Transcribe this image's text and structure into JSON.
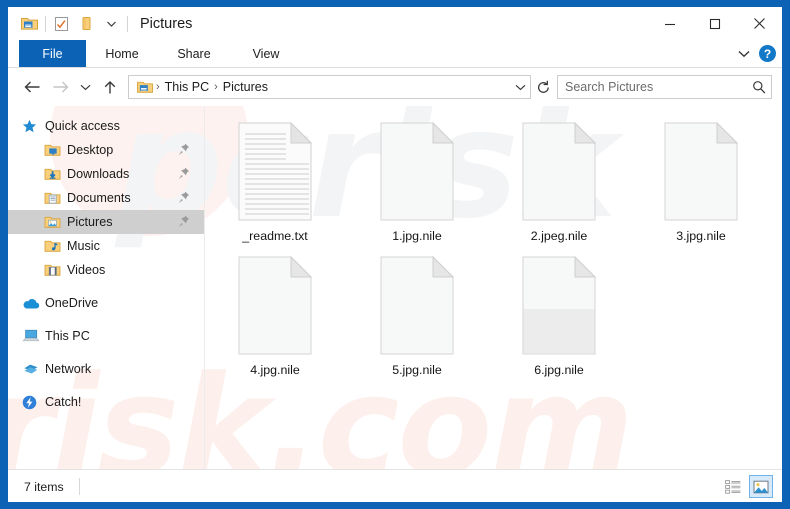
{
  "window": {
    "title": "Pictures",
    "frame_color": "#0c62b5",
    "accent_color": "#0c62b5"
  },
  "quick_access_toolbar": {
    "items": [
      {
        "name": "explorer-icon",
        "label": "Pictures properties"
      },
      {
        "name": "properties-icon",
        "label": "Properties"
      },
      {
        "name": "new-folder-icon",
        "label": "New folder"
      },
      {
        "name": "customize-chevron-icon",
        "label": "Customize Quick Access Toolbar"
      }
    ]
  },
  "window_controls": {
    "minimize": "Minimize",
    "maximize": "Maximize",
    "close": "Close"
  },
  "ribbon": {
    "tabs": [
      {
        "label": "File",
        "selected": true
      },
      {
        "label": "Home",
        "selected": false
      },
      {
        "label": "Share",
        "selected": false
      },
      {
        "label": "View",
        "selected": false
      }
    ],
    "expand_label": "Expand the Ribbon",
    "help_label": "?"
  },
  "navigation": {
    "back": "Back",
    "forward": "Forward",
    "recent": "Recent locations",
    "up": "Up",
    "refresh": "Refresh"
  },
  "address_bar": {
    "crumbs": [
      {
        "label": "This PC"
      },
      {
        "label": "Pictures"
      }
    ],
    "separator": "›"
  },
  "search": {
    "placeholder": "Search Pictures",
    "value": ""
  },
  "sidebar": {
    "items": [
      {
        "label": "Quick access",
        "icon": "star-icon",
        "type": "root",
        "selected": false,
        "pinned": false
      },
      {
        "label": "Desktop",
        "icon": "folder-desktop-icon",
        "type": "child",
        "selected": false,
        "pinned": true
      },
      {
        "label": "Downloads",
        "icon": "folder-downloads-icon",
        "type": "child",
        "selected": false,
        "pinned": true
      },
      {
        "label": "Documents",
        "icon": "folder-documents-icon",
        "type": "child",
        "selected": false,
        "pinned": true
      },
      {
        "label": "Pictures",
        "icon": "folder-pictures-icon",
        "type": "child",
        "selected": true,
        "pinned": true
      },
      {
        "label": "Music",
        "icon": "folder-music-icon",
        "type": "child",
        "selected": false,
        "pinned": false
      },
      {
        "label": "Videos",
        "icon": "folder-videos-icon",
        "type": "child",
        "selected": false,
        "pinned": false
      },
      {
        "label": "OneDrive",
        "icon": "onedrive-cloud-icon",
        "type": "root",
        "selected": false,
        "pinned": false
      },
      {
        "label": "This PC",
        "icon": "this-pc-icon",
        "type": "root",
        "selected": false,
        "pinned": false
      },
      {
        "label": "Network",
        "icon": "network-icon",
        "type": "root",
        "selected": false,
        "pinned": false
      },
      {
        "label": "Catch!",
        "icon": "catch-lightning-icon",
        "type": "root",
        "selected": false,
        "pinned": false
      }
    ]
  },
  "files": [
    {
      "name": "_readme.txt",
      "icon": "text-document-icon"
    },
    {
      "name": "1.jpg.nile",
      "icon": "blank-document-icon"
    },
    {
      "name": "2.jpeg.nile",
      "icon": "blank-document-icon"
    },
    {
      "name": "3.jpg.nile",
      "icon": "blank-document-icon"
    },
    {
      "name": "4.jpg.nile",
      "icon": "blank-document-icon"
    },
    {
      "name": "5.jpg.nile",
      "icon": "blank-document-icon"
    },
    {
      "name": "6.jpg.nile",
      "icon": "blank-document-icon"
    }
  ],
  "status_bar": {
    "item_count_text": "7 items",
    "views": [
      {
        "name": "details-view",
        "label": "Details view",
        "active": false
      },
      {
        "name": "large-icons-view",
        "label": "Large icons view",
        "active": true
      }
    ]
  },
  "watermark": {
    "top_text": "pcrisk",
    "bottom_text": "risk.com"
  }
}
